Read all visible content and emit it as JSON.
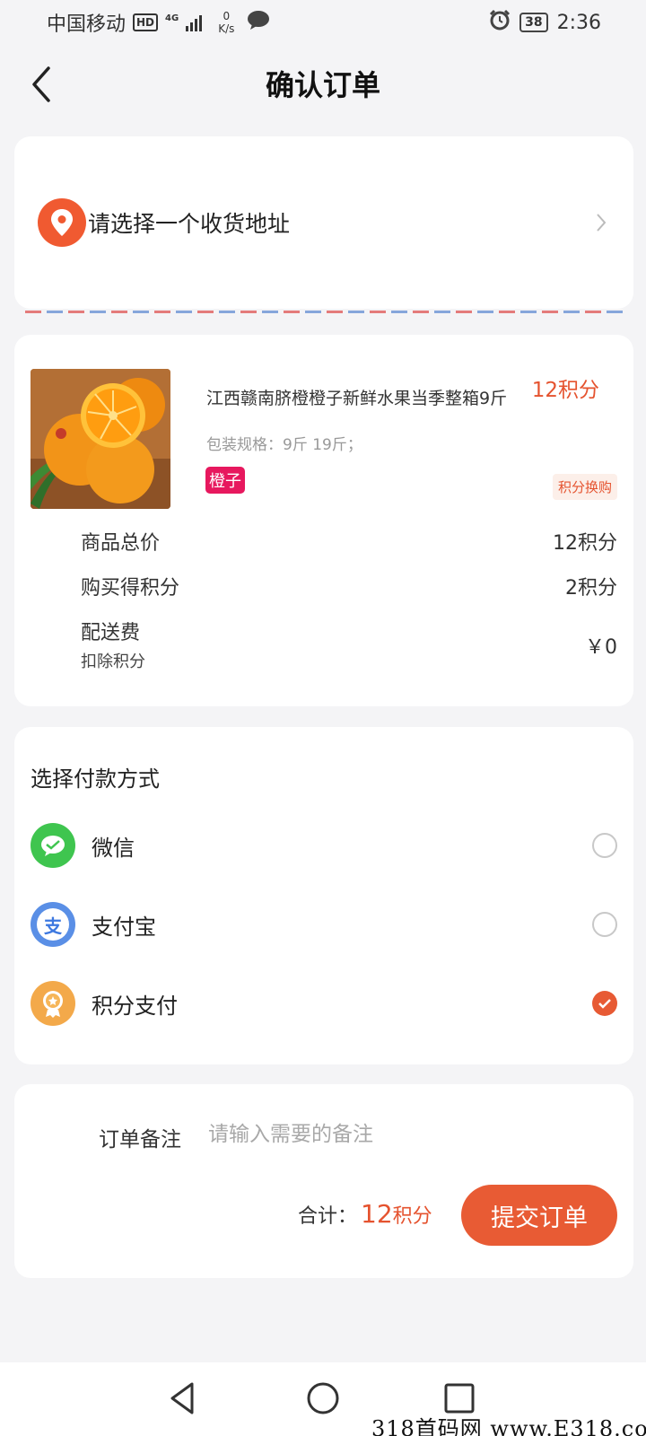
{
  "status_bar": {
    "carrier": "中国移动",
    "hd": "HD",
    "network": "4G",
    "speed_value": "0",
    "speed_unit": "K/s",
    "battery": "38",
    "time": "2:36"
  },
  "header": {
    "title": "确认订单"
  },
  "address": {
    "placeholder": "请选择一个收货地址"
  },
  "product": {
    "name": "江西赣南脐橙橙子新鲜水果当季整箱9斤",
    "spec": "包装规格：9斤 19斤；",
    "tag": "橙子",
    "price": "12积分",
    "badge": "积分换购"
  },
  "summary": {
    "rows": [
      {
        "label": "商品总价",
        "value": "12积分"
      },
      {
        "label": "购买得积分",
        "value": "2积分"
      },
      {
        "label": "配送费",
        "value": "￥0"
      }
    ],
    "delivery_sub": "扣除积分"
  },
  "payment": {
    "title": "选择付款方式",
    "options": [
      {
        "label": "微信",
        "icon": "wechat-icon",
        "selected": false
      },
      {
        "label": "支付宝",
        "icon": "alipay-icon",
        "selected": false
      },
      {
        "label": "积分支付",
        "icon": "points-icon",
        "selected": true
      }
    ]
  },
  "note": {
    "label": "订单备注",
    "placeholder": "请输入需要的备注",
    "value": ""
  },
  "checkout": {
    "total_label": "合计：",
    "total_value": "12",
    "total_unit": "积分",
    "submit_label": "提交订单"
  },
  "watermark": "318首码网 www.E318.com",
  "colors": {
    "accent": "#e85b34",
    "tag": "#e7185e",
    "wechat": "#3fc54f",
    "alipay": "#5a8fe6",
    "points": "#f3a94a"
  }
}
